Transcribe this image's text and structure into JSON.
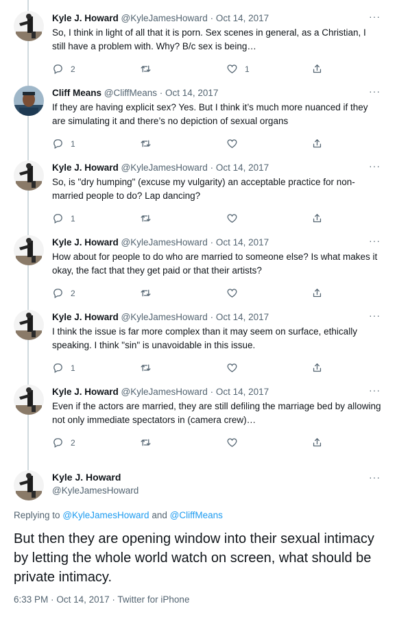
{
  "tweets": [
    {
      "name": "Kyle J. Howard",
      "handle": "@KyleJamesHoward",
      "date": "Oct 14, 2017",
      "text": "So, I think in light of all that it is porn. Sex scenes in general, as a Christian, I still have a problem with. Why? B/c sex is being…",
      "replies": "2",
      "retweets": "",
      "likes": "1"
    },
    {
      "name": "Cliff Means",
      "handle": "@CliffMeans",
      "date": "Oct 14, 2017",
      "text": "If they are having explicit sex? Yes. But I think it’s much more nuanced if they are simulating it and there’s no depiction of sexual organs",
      "replies": "1",
      "retweets": "",
      "likes": ""
    },
    {
      "name": "Kyle J. Howard",
      "handle": "@KyleJamesHoward",
      "date": "Oct 14, 2017",
      "text": "So, is \"dry humping\" (excuse my vulgarity) an acceptable practice for non-married people to do? Lap dancing?",
      "replies": "1",
      "retweets": "",
      "likes": ""
    },
    {
      "name": "Kyle J. Howard",
      "handle": "@KyleJamesHoward",
      "date": "Oct 14, 2017",
      "text": "How about for people to do who are married to someone else? Is what makes it okay, the fact that they get paid or that their artists?",
      "replies": "2",
      "retweets": "",
      "likes": ""
    },
    {
      "name": "Kyle J. Howard",
      "handle": "@KyleJamesHoward",
      "date": "Oct 14, 2017",
      "text": "I think the issue is far more complex than it may seem on surface, ethically speaking. I think \"sin\" is unavoidable in this issue.",
      "replies": "1",
      "retweets": "",
      "likes": ""
    },
    {
      "name": "Kyle J. Howard",
      "handle": "@KyleJamesHoward",
      "date": "Oct 14, 2017",
      "text": "Even if the actors are married, they are still defiling the marriage bed by allowing not only immediate spectators in (camera crew)…",
      "replies": "2",
      "retweets": "",
      "likes": ""
    }
  ],
  "separator": "·",
  "more": "···",
  "main": {
    "name": "Kyle J. Howard",
    "handle": "@KyleJamesHoward",
    "replying_prefix": "Replying to",
    "replying_user1": "@KyleJamesHoward",
    "replying_and": "and",
    "replying_user2": "@CliffMeans",
    "text": "But then they are opening window into their sexual intimacy by letting the whole world watch on screen, what should be private intimacy.",
    "time": "6:33 PM",
    "date": "Oct 14, 2017",
    "source": "Twitter for iPhone"
  },
  "colors": {
    "link": "#1d9bf0",
    "muted": "#536471",
    "text": "#0f1419",
    "thread": "#cfd9de"
  },
  "icons": [
    "reply-icon",
    "retweet-icon",
    "like-icon",
    "share-icon",
    "more-icon"
  ]
}
